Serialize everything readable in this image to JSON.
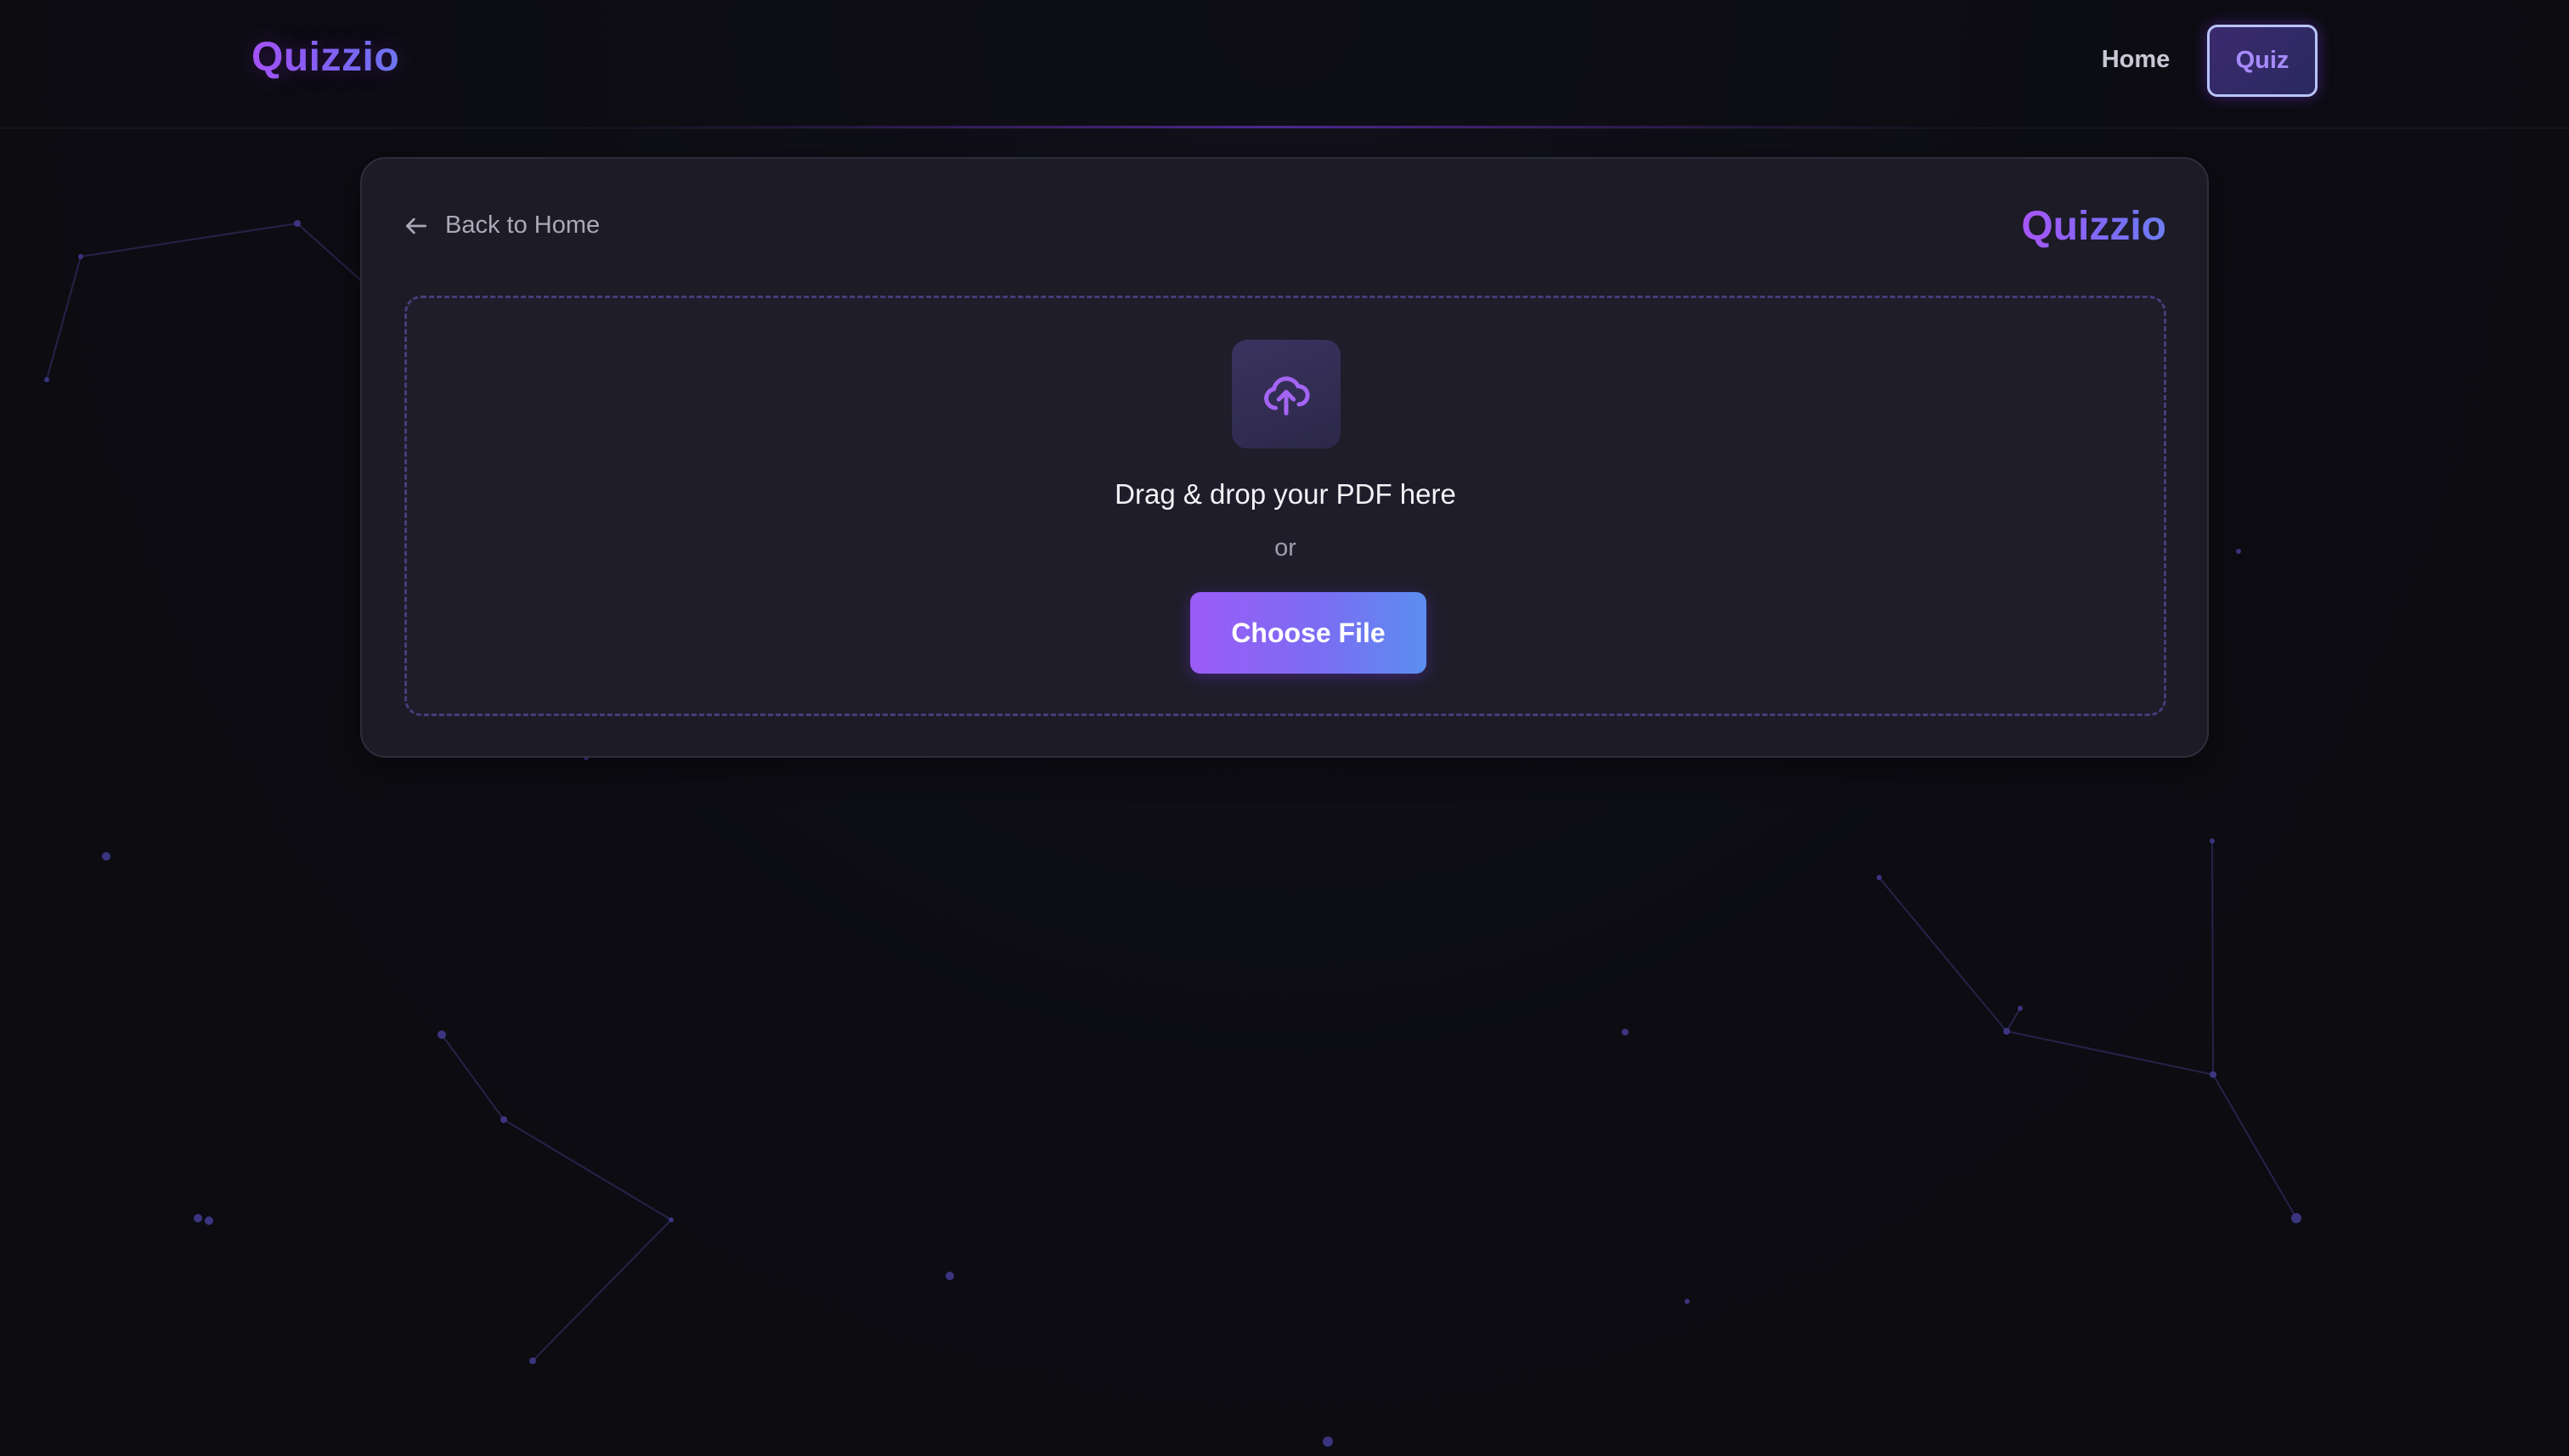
{
  "navbar": {
    "brand": "Quizzio",
    "links": {
      "home": "Home",
      "quiz": "Quiz"
    }
  },
  "card": {
    "back_link": "Back to Home",
    "brand": "Quizzio",
    "dropzone": {
      "icon": "cloud-upload-icon",
      "title": "Drag & drop your PDF here",
      "or": "or",
      "button": "Choose File"
    }
  },
  "colors": {
    "background": "#0c0c12",
    "card": "#1c1b26",
    "accent_purple": "#9b5cf6",
    "accent_blue": "#5b8ef0",
    "dashed_border": "#4b3a7a"
  }
}
